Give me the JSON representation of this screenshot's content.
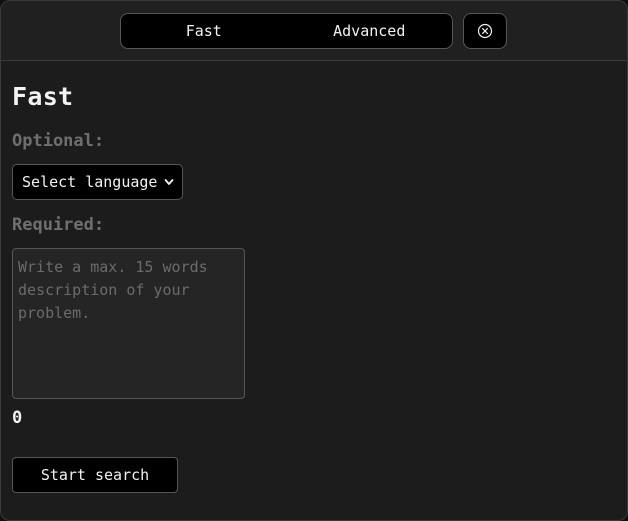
{
  "mode_switch": {
    "options": [
      "Fast",
      "Advanced"
    ],
    "selected": "Fast"
  },
  "close_button": {
    "icon": "close-circle-icon"
  },
  "panel": {
    "title": "Fast",
    "optional_label": "Optional:",
    "language_select": {
      "selected": "Select language",
      "icon": "chevron-down-icon"
    },
    "required_label": "Required:",
    "description": {
      "value": "",
      "placeholder": "Write a max. 15 words\ndescription of your\nproblem."
    },
    "word_count": "0",
    "start_button_label": "Start search"
  },
  "colors": {
    "background": "#1c1c1c",
    "control_background": "#000000",
    "border": "#565656",
    "text": "#f2f2f2",
    "muted_text": "#6f6f6f"
  }
}
